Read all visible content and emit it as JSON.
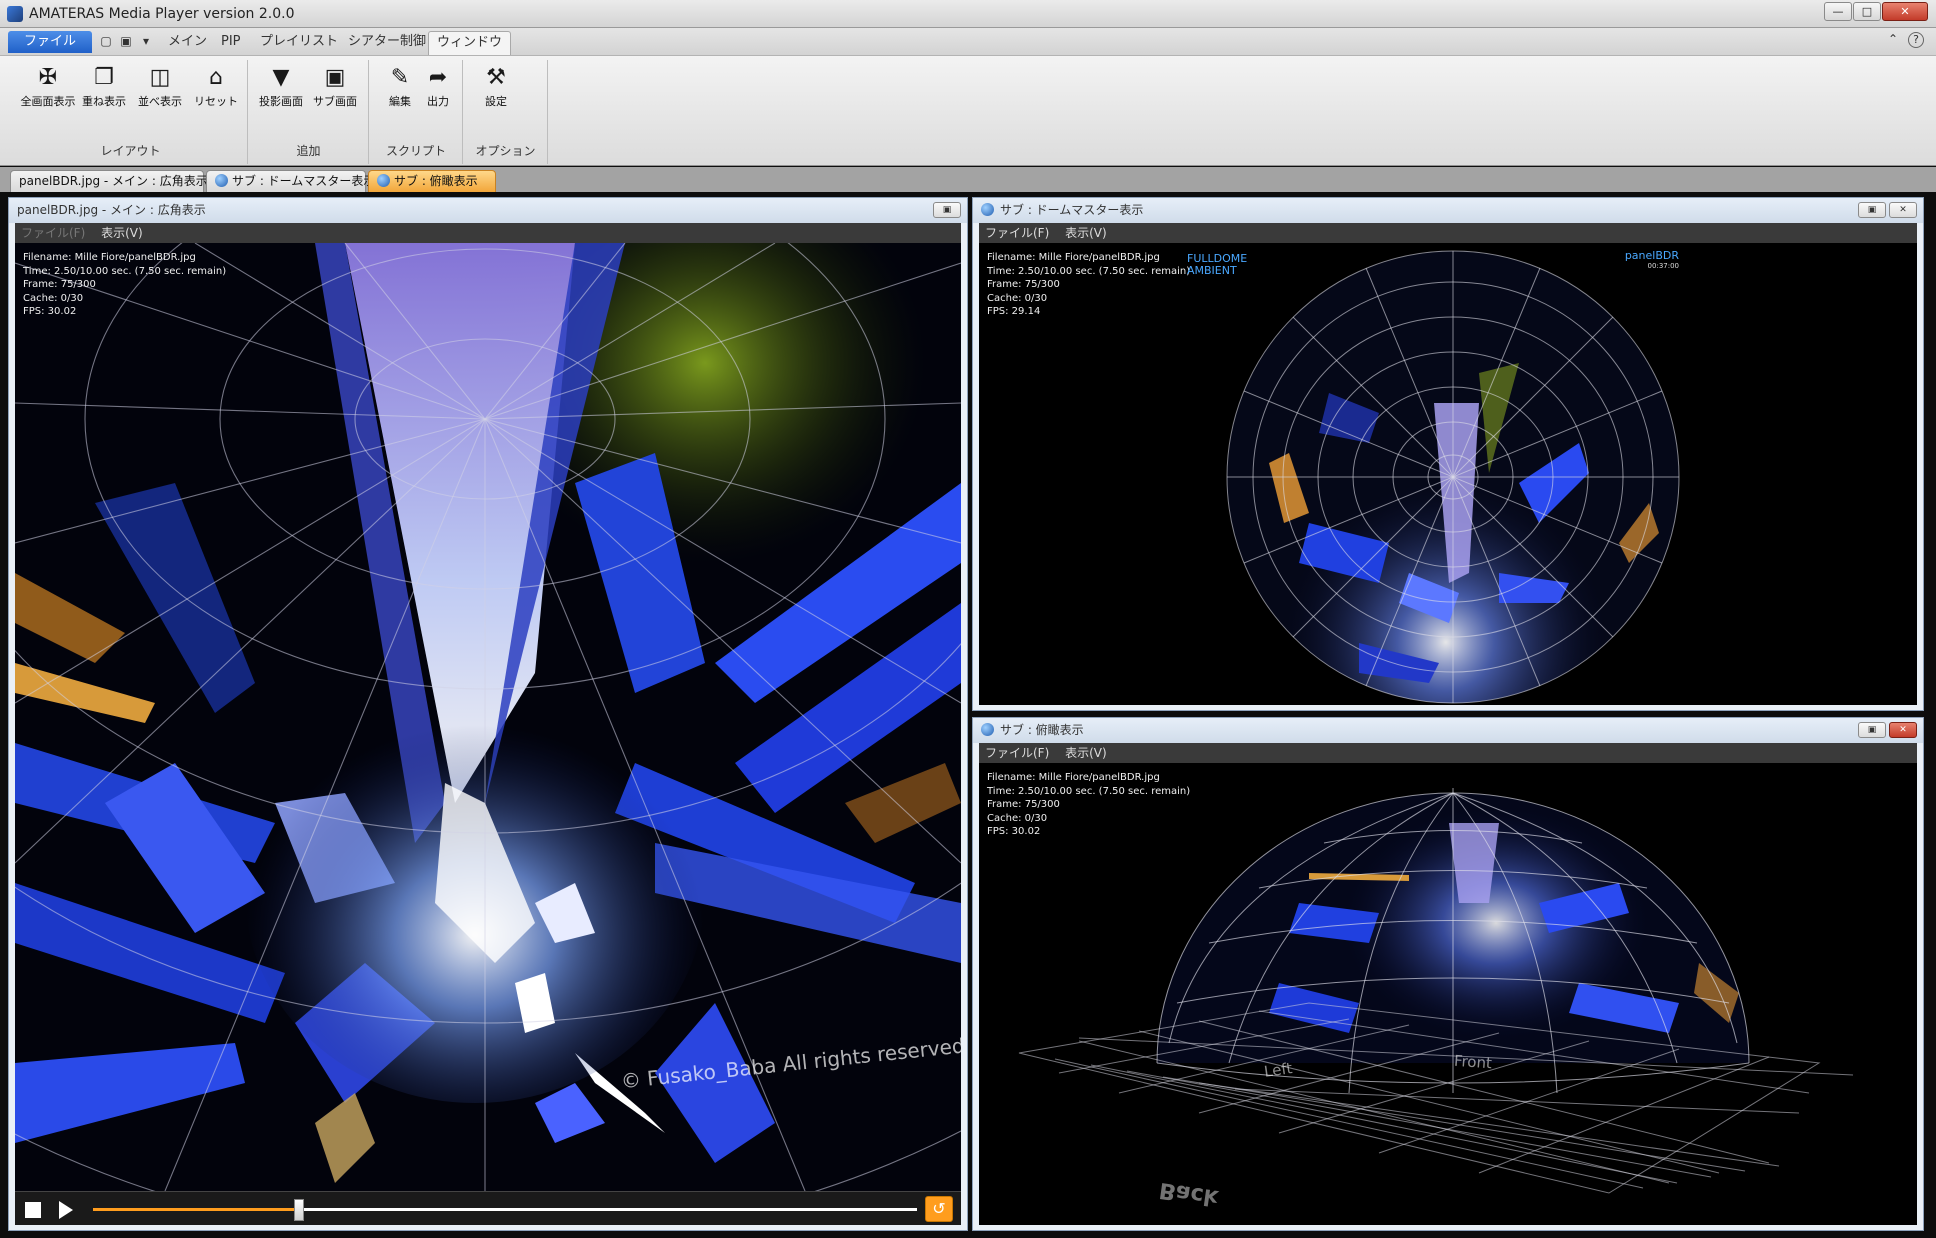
{
  "window": {
    "title": "AMATERAS Media Player version 2.0.0"
  },
  "ribbon": {
    "file_tab": "ファイル",
    "tabs": [
      "メイン",
      "PIP",
      "プレイリスト",
      "シアター制御",
      "ウィンドウ"
    ],
    "active_tab": "ウィンドウ",
    "help": "?",
    "groups": {
      "layout": {
        "label": "レイアウト",
        "buttons": [
          "全画面表示",
          "重ね表示",
          "並べ表示",
          "リセット"
        ]
      },
      "add": {
        "label": "追加",
        "buttons": [
          "投影画面",
          "サブ画面"
        ]
      },
      "script": {
        "label": "スクリプト",
        "buttons": [
          "編集",
          "出力"
        ]
      },
      "option": {
        "label": "オプション",
        "buttons": [
          "設定"
        ]
      }
    }
  },
  "doc_tabs": [
    {
      "label": "panelBDR.jpg - メイン : 広角表示"
    },
    {
      "label": "サブ : ドームマスター表示"
    },
    {
      "label": "サブ : 俯瞰表示"
    }
  ],
  "main_panel": {
    "title": "panelBDR.jpg - メイン : 広角表示",
    "menu_file": "ファイル(F)",
    "menu_view": "表示(V)",
    "info": [
      "Filename: Mille Fiore/panelBDR.jpg",
      "Time: 2.50/10.00 sec. (7.50 sec. remain)",
      "Frame: 75/300",
      "Cache: 0/30",
      "FPS: 30.02"
    ],
    "watermark": "© Fusako_Baba  All rights reserved.",
    "progress": 0.25
  },
  "dome_panel": {
    "title": "サブ : ドームマスター表示",
    "menu_file": "ファイル(F)",
    "menu_view": "表示(V)",
    "info": [
      "Filename: Mille Fiore/panelBDR.jpg",
      "Time: 2.50/10.00 sec. (7.50 sec. remain)",
      "Frame: 75/300",
      "Cache: 0/30",
      "FPS: 29.14"
    ],
    "label_left_1": "FULLDOME",
    "label_left_2": "AMBIENT",
    "label_right": "panelBDR",
    "label_right_time": "00:37:00"
  },
  "overview_panel": {
    "title": "サブ : 俯瞰表示",
    "menu_file": "ファイル(F)",
    "menu_view": "表示(V)",
    "info": [
      "Filename: Mille Fiore/panelBDR.jpg",
      "Time: 2.50/10.00 sec. (7.50 sec. remain)",
      "Frame: 75/300",
      "Cache: 0/30",
      "FPS: 30.02"
    ],
    "label_left": "Left",
    "label_front": "Front",
    "label_back": "Back"
  },
  "colors": {
    "accent_orange": "#ff9d1e",
    "file_tab_blue": "#2f74d8",
    "close_red": "#c33b2a"
  }
}
